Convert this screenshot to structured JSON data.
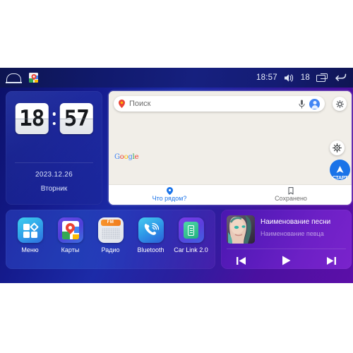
{
  "statusbar": {
    "home_icon": "home-icon",
    "app_icon": "google-maps-icon",
    "time": "18:57",
    "volume_icon": "volume-icon",
    "volume_level": "18",
    "recents_icon": "recents-icon",
    "back_icon": "back-icon"
  },
  "clock": {
    "hours": "18",
    "minutes": "57",
    "date": "2023.12.26",
    "weekday": "Вторник"
  },
  "maps": {
    "search_placeholder": "Поиск",
    "pin_icon": "map-pin-icon",
    "mic_icon": "microphone-icon",
    "avatar_icon": "account-avatar-icon",
    "layers_icon": "layers-settings-icon",
    "compass_icon": "compass-target-icon",
    "start_label": "СТАРТ",
    "google_logo": {
      "g": "G",
      "o1": "o",
      "o2": "o",
      "g2": "g",
      "l": "l",
      "e": "e"
    },
    "tabs": [
      {
        "label": "Что рядом?",
        "icon": "location-pin-icon",
        "active": true
      },
      {
        "label": "Сохранено",
        "icon": "bookmark-icon",
        "active": false
      }
    ]
  },
  "dock": {
    "apps": [
      {
        "label": "Меню",
        "icon": "apps-grid-icon"
      },
      {
        "label": "Карты",
        "icon": "google-maps-icon"
      },
      {
        "label": "Радио",
        "icon": "fm-radio-icon",
        "band": "FM"
      },
      {
        "label": "Bluetooth",
        "icon": "phone-signal-icon"
      },
      {
        "label": "Car Link 2.0",
        "icon": "car-link-phone-icon"
      }
    ]
  },
  "music": {
    "album_art": "album-art-portrait",
    "title": "Наименование песни",
    "artist": "Наименование певца",
    "controls": [
      {
        "name": "previous-track-button",
        "icon": "skip-previous-icon"
      },
      {
        "name": "play-button",
        "icon": "play-icon"
      },
      {
        "name": "next-track-button",
        "icon": "skip-next-icon"
      }
    ]
  },
  "colors": {
    "bg_blue": "#141a8c",
    "bg_purple": "#5c0fa8",
    "map_bg": "#f1eee8",
    "accent_blue": "#1a73e8",
    "music_purple": "#6d20c6"
  }
}
